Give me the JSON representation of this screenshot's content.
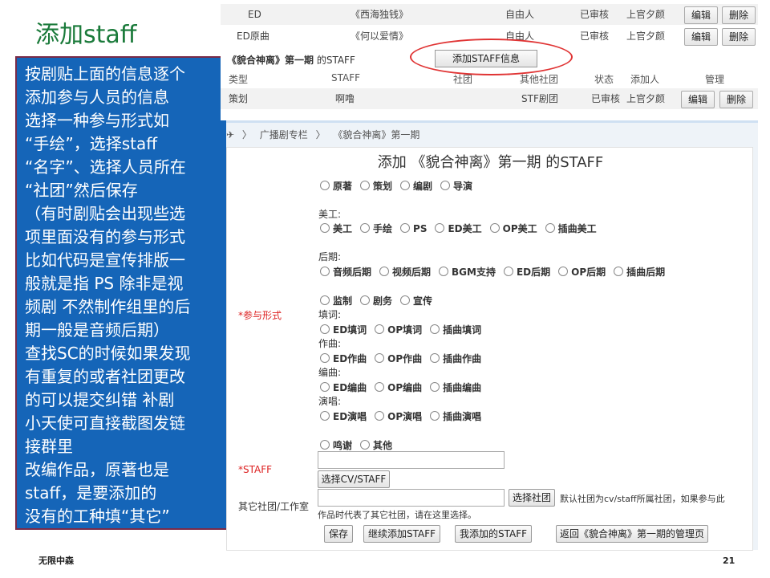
{
  "slide": {
    "title": "添加staff",
    "page_number": "21",
    "footer_logo": "无限中森",
    "notes": [
      "按剧贴上面的信息逐个",
      "添加参与人员的信息",
      "选择一种参与形式如",
      "“手绘”，选择staff",
      "“名字”、选择人员所在",
      "“社团”然后保存",
      "（有时剧贴会出现些选",
      "项里面没有的参与形式",
      "比如代码是宣传排版一",
      "般就是指 PS 除非是视",
      "频剧 不然制作组里的后",
      "期一般是音频后期）",
      "查找SC的时候如果发现",
      "有重复的或者社团更改",
      "的可以提交纠错  补剧",
      "小天使可直接截图发链",
      "接群里",
      "改编作品，原著也是",
      "staff，是要添加的",
      " 没有的工种填“其它”"
    ]
  },
  "top_table": {
    "rows": [
      {
        "type": "ED",
        "work": "《西海独钱》",
        "club": "自由人",
        "status": "已审核",
        "adder": "上官夕颜",
        "edit": "编辑",
        "delete": "删除"
      },
      {
        "type": "ED原曲",
        "work": "《何以爱情》",
        "club": "自由人",
        "status": "已审核",
        "adder": "上官夕颜",
        "edit": "编辑",
        "delete": "删除"
      }
    ],
    "section_title_bold": "《貌合神离》第一期",
    "section_title_rest": " 的STAFF",
    "add_staff_button": "添加STAFF信息",
    "headers": {
      "type": "类型",
      "staff": "STAFF",
      "club": "社团",
      "other_club": "其他社团",
      "status": "状态",
      "adder": "添加人",
      "manage": "管理"
    },
    "staff_row": {
      "type": "策划",
      "staff": "啊噜",
      "other_club": "STF剧团",
      "status": "已审核",
      "adder": "上官夕颜",
      "edit": "编辑",
      "delete": "删除"
    }
  },
  "form": {
    "breadcrumb": [
      "✈",
      "〉",
      "广播剧专栏",
      "〉",
      "《貌合神离》第一期"
    ],
    "title": "添加 《貌合神离》第一期 的STAFF",
    "role_label": "*参与形式",
    "group_main": [
      "原著",
      "策划",
      "编剧",
      "导演"
    ],
    "art_label": "美工:",
    "group_art": [
      "美工",
      "手绘",
      "PS",
      "ED美工",
      "OP美工",
      "插曲美工"
    ],
    "post_label": "后期:",
    "group_post": [
      "音频后期",
      "视频后期",
      "BGM支持",
      "ED后期",
      "OP后期",
      "插曲后期"
    ],
    "group_misc": [
      "监制",
      "剧务",
      "宣传"
    ],
    "lyrics_label": "填词:",
    "group_lyrics": [
      "ED填词",
      "OP填词",
      "插曲填词"
    ],
    "compose_label": "作曲:",
    "group_compose": [
      "ED作曲",
      "OP作曲",
      "插曲作曲"
    ],
    "arrange_label": "编曲:",
    "group_arrange": [
      "ED编曲",
      "OP编曲",
      "插曲编曲"
    ],
    "sing_label": "演唱:",
    "group_sing": [
      "ED演唱",
      "OP演唱",
      "插曲演唱"
    ],
    "group_thanks": [
      "鸣谢",
      "其他"
    ],
    "staff_label": "*STAFF",
    "staff_value": "",
    "select_staff_button": "选择CV/STAFF",
    "other_club_label": "其它社团/工作室",
    "other_club_value": "",
    "select_club_button": "选择社团",
    "hint_line1": "默认社团为cv/staff所属社团，如果参与此",
    "hint_line2": "作品时代表了其它社团，请在这里选择。",
    "save_button": "保存",
    "continue_button": "继续添加STAFF",
    "my_added_button": "我添加的STAFF",
    "back_button": "返回《貌合神离》第一期的管理页"
  }
}
